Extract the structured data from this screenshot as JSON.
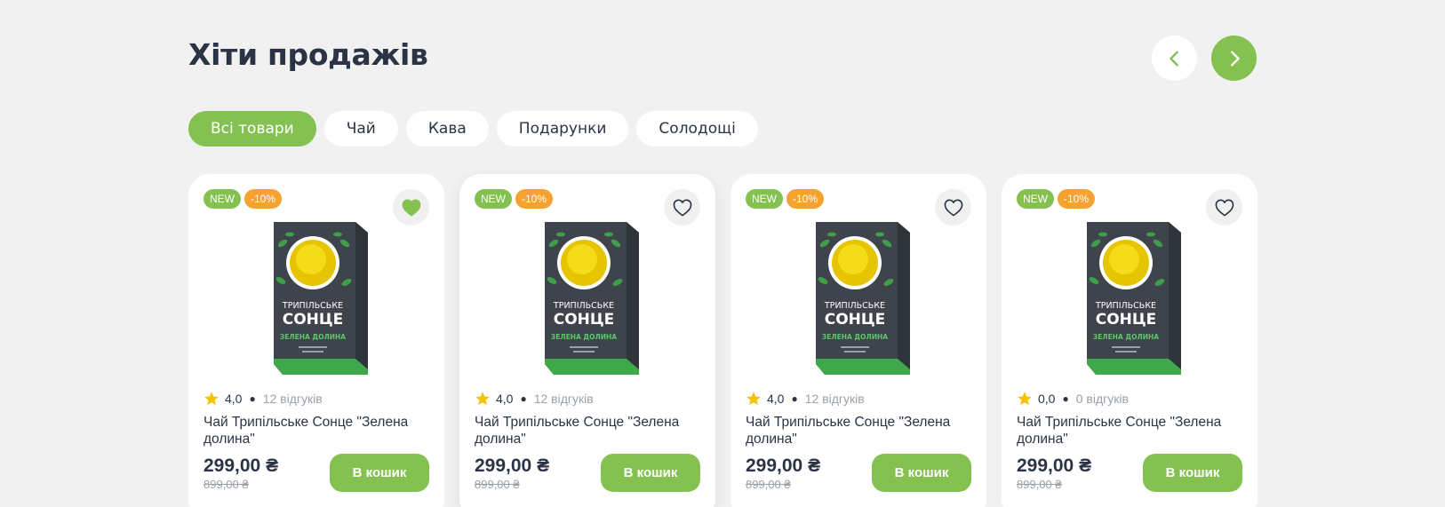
{
  "section": {
    "title": "Хіти продажів"
  },
  "nav": {
    "prev_icon": "chevron-left-icon",
    "next_icon": "chevron-right-icon"
  },
  "filters": [
    {
      "label": "Всі товари",
      "active": true
    },
    {
      "label": "Чай",
      "active": false
    },
    {
      "label": "Кава",
      "active": false
    },
    {
      "label": "Подарунки",
      "active": false
    },
    {
      "label": "Солодощі",
      "active": false
    }
  ],
  "colors": {
    "accent": "#84c150",
    "sale": "#f6a233",
    "text": "#2b3445",
    "muted": "#9aa0a8",
    "background": "#f1f1f1"
  },
  "products": [
    {
      "badge_new": "NEW",
      "badge_sale": "-10%",
      "favorited": true,
      "rating": "4,0",
      "reviews": "12 відгуків",
      "name": "Чай Трипільське Сонце \"Зелена долина\"",
      "price": "299,00 ₴",
      "old_price": "899,00 ₴",
      "buy_label": "В кошик"
    },
    {
      "badge_new": "NEW",
      "badge_sale": "-10%",
      "favorited": false,
      "rating": "4,0",
      "reviews": "12 відгуків",
      "name": "Чай Трипільське Сонце \"Зелена долина\"",
      "price": "299,00 ₴",
      "old_price": "899,00 ₴",
      "buy_label": "В кошик"
    },
    {
      "badge_new": "NEW",
      "badge_sale": "-10%",
      "favorited": false,
      "rating": "4,0",
      "reviews": "12 відгуків",
      "name": "Чай Трипільське Сонце \"Зелена долина\"",
      "price": "299,00 ₴",
      "old_price": "899,00 ₴",
      "buy_label": "В кошик"
    },
    {
      "badge_new": "NEW",
      "badge_sale": "-10%",
      "favorited": false,
      "rating": "0,0",
      "reviews": "0 відгуків",
      "name": "Чай Трипільське Сонце \"Зелена долина\"",
      "price": "299,00 ₴",
      "old_price": "899,00 ₴",
      "buy_label": "В кошик"
    }
  ],
  "package": {
    "line1": "ТРИПІЛЬСЬКЕ",
    "line2": "СОНЦЕ",
    "line3": "ЗЕЛЕНА ДОЛИНА"
  }
}
